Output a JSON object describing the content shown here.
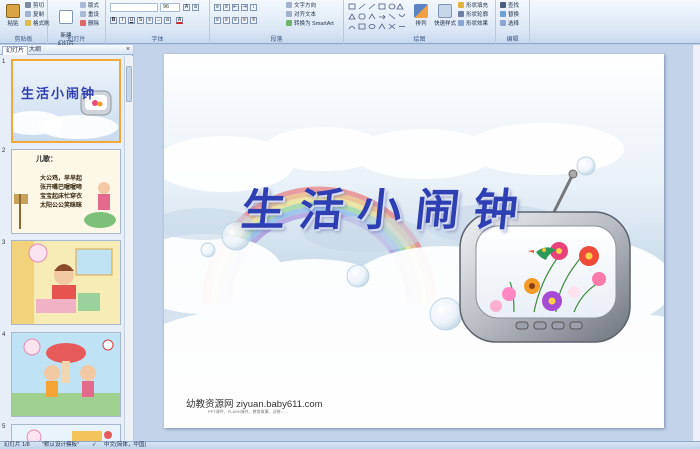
{
  "ribbon": {
    "clipboard": {
      "label": "剪贴板",
      "paste": "粘贴",
      "cut": "剪切",
      "copy": "复制",
      "format_painter": "格式刷"
    },
    "slides": {
      "label": "幻灯片",
      "new_slide": "新建\n幻灯片",
      "layout": "版式",
      "reset": "重设",
      "delete": "删除"
    },
    "font": {
      "label": "字体",
      "font_size": "96"
    },
    "paragraph": {
      "label": "段落",
      "text_direction": "文字方向",
      "align_text": "对齐文本",
      "smartart": "转换为 SmartArt"
    },
    "drawing": {
      "label": "绘图",
      "arrange": "排列",
      "quick_styles": "快速样式",
      "shape_fill": "形状填充",
      "shape_outline": "形状轮廓",
      "shape_effects": "形状效果"
    },
    "editing": {
      "label": "编辑",
      "find": "查找",
      "replace": "替换",
      "select": "选择"
    }
  },
  "pane": {
    "tab_slides": "幻灯片",
    "tab_outline": "大纲",
    "close": "×"
  },
  "thumbnails": [
    {
      "num": "1",
      "title": "生活小闹钟"
    },
    {
      "num": "2",
      "heading": "儿歌：",
      "lines": [
        "大公鸡，早早起",
        "张开嘴巴喔喔啼",
        "宝宝起床忙穿衣",
        "太阳公公笑眯眯"
      ]
    },
    {
      "num": "3"
    },
    {
      "num": "4"
    },
    {
      "num": "5"
    }
  ],
  "slide": {
    "title": "生活小闹钟",
    "watermark": "幼教资源网 ziyuan.baby611.com",
    "watermark_sub": "PPT课件、FLASH课件、教育故事、试卷……"
  },
  "status": {
    "slide_count": "幻灯片 1/8",
    "theme": "\"默认设计模板\"",
    "language": "中文(简体，中国)"
  },
  "colors": {
    "title": "#2e3fb3",
    "ribbon_border": "#8ea8cc",
    "selected_thumb": "#f2a93b"
  }
}
